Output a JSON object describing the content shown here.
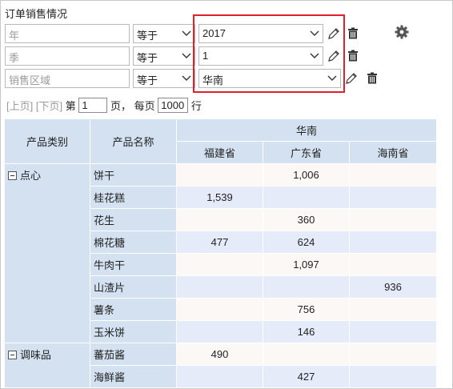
{
  "title": "订单销售情况",
  "filters": [
    {
      "field": "年",
      "op": "等于",
      "value": "2017"
    },
    {
      "field": "季",
      "op": "等于",
      "value": "1"
    },
    {
      "field": "销售区域",
      "op": "等于",
      "value": "华南"
    }
  ],
  "pager": {
    "prev": "[上页]",
    "next": "[下页]",
    "page_prefix": "第",
    "page": "1",
    "page_suffix": "页，",
    "per_page_prefix": "每页",
    "per_page": "1000",
    "per_page_suffix": "行"
  },
  "table": {
    "header_category": "产品类别",
    "header_product": "产品名称",
    "region": "华南",
    "provinces": [
      "福建省",
      "广东省",
      "海南省"
    ],
    "groups": [
      {
        "category": "点心",
        "rows": [
          {
            "product": "饼干",
            "values": [
              "",
              "1,006",
              ""
            ]
          },
          {
            "product": "桂花糕",
            "values": [
              "1,539",
              "",
              ""
            ]
          },
          {
            "product": "花生",
            "values": [
              "",
              "360",
              ""
            ]
          },
          {
            "product": "棉花糖",
            "values": [
              "477",
              "624",
              ""
            ]
          },
          {
            "product": "牛肉干",
            "values": [
              "",
              "1,097",
              ""
            ]
          },
          {
            "product": "山渣片",
            "values": [
              "",
              "",
              "936"
            ]
          },
          {
            "product": "薯条",
            "values": [
              "",
              "756",
              ""
            ]
          },
          {
            "product": "玉米饼",
            "values": [
              "",
              "146",
              ""
            ]
          }
        ]
      },
      {
        "category": "调味品",
        "rows": [
          {
            "product": "蕃茄酱",
            "values": [
              "490",
              "",
              ""
            ]
          },
          {
            "product": "海鲜酱",
            "values": [
              "",
              "427",
              ""
            ]
          }
        ]
      }
    ]
  },
  "icons": {
    "edit": "pencil-icon",
    "delete": "trash-icon",
    "settings": "gear-icon",
    "dropdown": "chevron-down-icon",
    "collapse": "collapse-minus-icon"
  },
  "colors": {
    "highlight": "#e0202a",
    "header_bg": "#d3e1f1",
    "row_alt_a": "#fbf8f6",
    "row_alt_b": "#e6ebfa"
  }
}
